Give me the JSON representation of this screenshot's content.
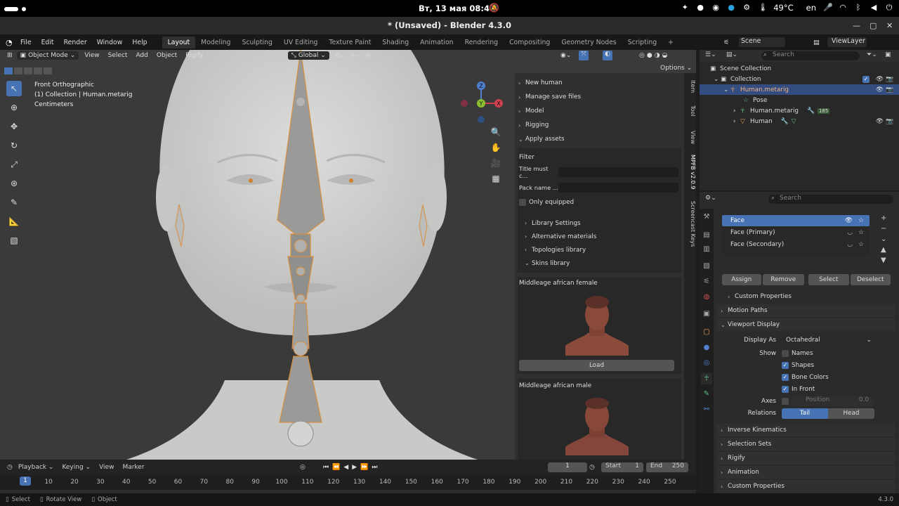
{
  "os": {
    "clock": "Вт, 13 мая  08:40",
    "temp": "49°C",
    "lang": "en"
  },
  "window": {
    "title": "* (Unsaved) - Blender 4.3.0"
  },
  "menu": {
    "items": [
      "File",
      "Edit",
      "Render",
      "Window",
      "Help"
    ],
    "workspaces": [
      "Layout",
      "Modeling",
      "Sculpting",
      "UV Editing",
      "Texture Paint",
      "Shading",
      "Animation",
      "Rendering",
      "Compositing",
      "Geometry Nodes",
      "Scripting"
    ],
    "scene": "Scene",
    "view_layer": "ViewLayer"
  },
  "viewport": {
    "mode": "Object Mode",
    "menus": [
      "View",
      "Select",
      "Add",
      "Object",
      "Rigify"
    ],
    "orientation": "Global",
    "options": "Options",
    "overlay_lines": [
      "Front Orthographic",
      "(1) Collection | Human.metarig",
      "Centimeters"
    ],
    "gizmo_labels": [
      "Z",
      "Y",
      "X"
    ]
  },
  "npanel": {
    "sections": [
      "New human",
      "Manage save files",
      "Model",
      "Rigging",
      "Apply assets"
    ],
    "filter_label": "Filter",
    "title_label": "Title must c...",
    "pack_label": "Pack name ...",
    "only_equipped": "Only equipped",
    "libraries": [
      "Library Settings",
      "Alternative materials",
      "Topologies library",
      "Skins library"
    ],
    "skin1": "Middleage african female",
    "load": "Load",
    "skin2": "Middleage african male",
    "tabs": [
      "Item",
      "Tool",
      "View",
      "MPFB v2.0.9",
      "Screencast Keys"
    ]
  },
  "timeline": {
    "menus": [
      "Playback",
      "Keying",
      "View",
      "Marker"
    ],
    "current_frame": "1",
    "start_label": "Start",
    "start": "1",
    "end_label": "End",
    "end": "250",
    "ticks": [
      "10",
      "20",
      "30",
      "40",
      "50",
      "60",
      "70",
      "80",
      "90",
      "100",
      "110",
      "120",
      "130",
      "140",
      "150",
      "160",
      "170",
      "180",
      "190",
      "200",
      "210",
      "220",
      "230",
      "240",
      "250"
    ],
    "marker": "1"
  },
  "status": {
    "items": [
      "Select",
      "Rotate View",
      "Object"
    ],
    "version": "4.3.0"
  },
  "outliner": {
    "search": "Search",
    "rows": [
      "Scene Collection",
      "Collection",
      "Human.metarig",
      "Pose",
      "Human.metarig",
      "Human"
    ],
    "badge": "185"
  },
  "properties": {
    "search": "Search",
    "bone_collections": [
      "Face",
      "Face (Primary)",
      "Face (Secondary)"
    ],
    "buttons": [
      "Assign",
      "Remove",
      "Select",
      "Deselect"
    ],
    "custom_props_1": "Custom Properties",
    "motion_paths": "Motion Paths",
    "viewport_display": "Viewport Display",
    "display_as_label": "Display As",
    "display_as": "Octahedral",
    "show_label": "Show",
    "names": "Names",
    "shapes": "Shapes",
    "bone_colors": "Bone Colors",
    "in_front": "In Front",
    "axes_label": "Axes",
    "position_label": "Position",
    "position_value": "0.0",
    "relations_label": "Relations",
    "tail": "Tail",
    "head": "Head",
    "sections": [
      "Inverse Kinematics",
      "Selection Sets",
      "Rigify",
      "Animation",
      "Custom Properties"
    ]
  }
}
